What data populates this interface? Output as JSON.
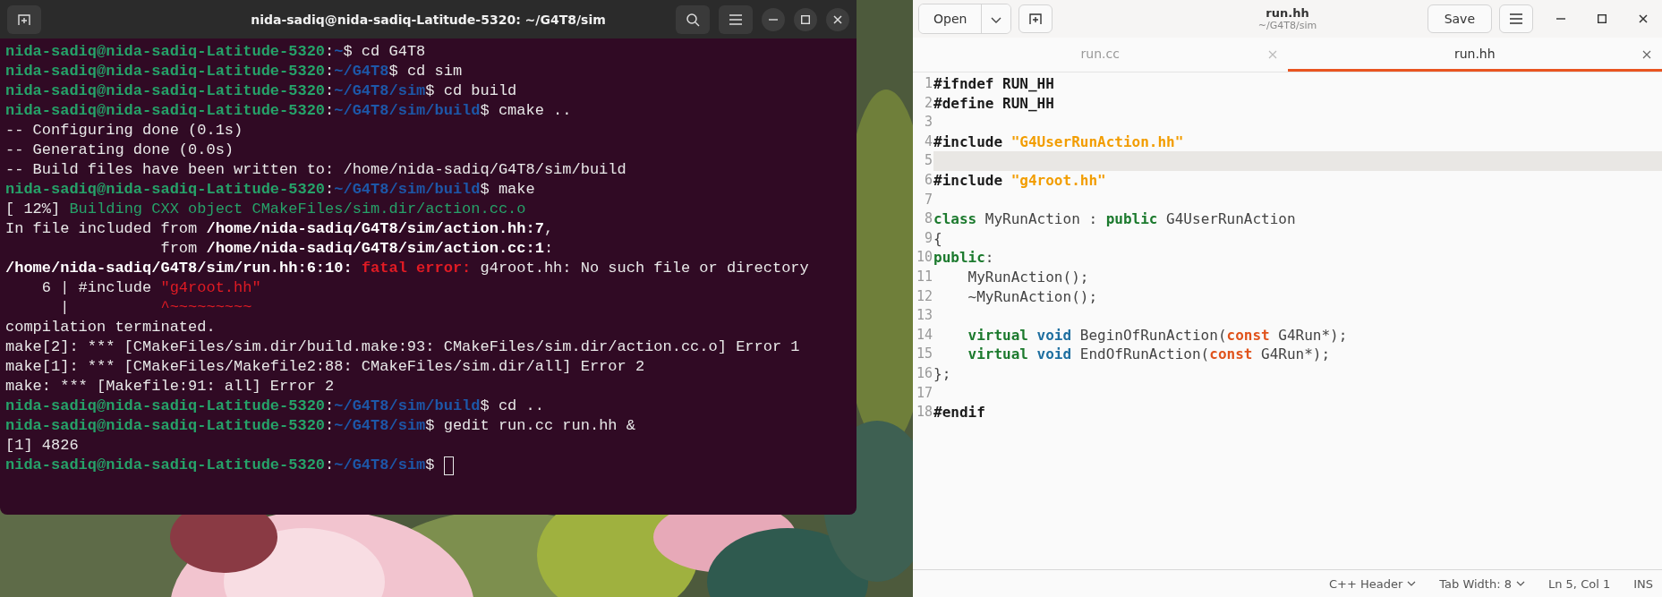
{
  "terminal": {
    "title": "nida-sadiq@nida-sadiq-Latitude-5320: ~/G4T8/sim",
    "cursor": true,
    "lines": [
      [
        {
          "kind": "user",
          "text": "nida-sadiq@nida-sadiq-Latitude-5320"
        },
        {
          "kind": "plain",
          "text": ":"
        },
        {
          "kind": "path",
          "text": "~"
        },
        {
          "kind": "plain",
          "text": "$ cd G4T8"
        }
      ],
      [
        {
          "kind": "user",
          "text": "nida-sadiq@nida-sadiq-Latitude-5320"
        },
        {
          "kind": "plain",
          "text": ":"
        },
        {
          "kind": "path",
          "text": "~/G4T8"
        },
        {
          "kind": "plain",
          "text": "$ cd sim"
        }
      ],
      [
        {
          "kind": "user",
          "text": "nida-sadiq@nida-sadiq-Latitude-5320"
        },
        {
          "kind": "plain",
          "text": ":"
        },
        {
          "kind": "path",
          "text": "~/G4T8/sim"
        },
        {
          "kind": "plain",
          "text": "$ cd build"
        }
      ],
      [
        {
          "kind": "user",
          "text": "nida-sadiq@nida-sadiq-Latitude-5320"
        },
        {
          "kind": "plain",
          "text": ":"
        },
        {
          "kind": "path",
          "text": "~/G4T8/sim/build"
        },
        {
          "kind": "plain",
          "text": "$ cmake .."
        }
      ],
      [
        {
          "kind": "plain",
          "text": "-- Configuring done (0.1s)"
        }
      ],
      [
        {
          "kind": "plain",
          "text": "-- Generating done (0.0s)"
        }
      ],
      [
        {
          "kind": "plain",
          "text": "-- Build files have been written to: /home/nida-sadiq/G4T8/sim/build"
        }
      ],
      [
        {
          "kind": "user",
          "text": "nida-sadiq@nida-sadiq-Latitude-5320"
        },
        {
          "kind": "plain",
          "text": ":"
        },
        {
          "kind": "path",
          "text": "~/G4T8/sim/build"
        },
        {
          "kind": "plain",
          "text": "$ make"
        }
      ],
      [
        {
          "kind": "plain",
          "text": "[ 12%] "
        },
        {
          "kind": "green",
          "text": "Building CXX object CMakeFiles/sim.dir/action.cc.o"
        }
      ],
      [
        {
          "kind": "plain",
          "text": "In file included from "
        },
        {
          "kind": "bold",
          "text": "/home/nida-sadiq/G4T8/sim/action.hh:7"
        },
        {
          "kind": "plain",
          "text": ","
        }
      ],
      [
        {
          "kind": "plain",
          "text": "                 from "
        },
        {
          "kind": "bold",
          "text": "/home/nida-sadiq/G4T8/sim/action.cc:1"
        },
        {
          "kind": "plain",
          "text": ":"
        }
      ],
      [
        {
          "kind": "bold",
          "text": "/home/nida-sadiq/G4T8/sim/run.hh:6:10: "
        },
        {
          "kind": "error",
          "text": "fatal error:"
        },
        {
          "kind": "plain",
          "text": " g4root.hh: No such file or directory"
        }
      ],
      [
        {
          "kind": "plain",
          "text": "    6 | #include "
        },
        {
          "kind": "red",
          "text": "\"g4root.hh\""
        }
      ],
      [
        {
          "kind": "plain",
          "text": "      |          "
        },
        {
          "kind": "red",
          "text": "^~~~~~~~~~"
        }
      ],
      [
        {
          "kind": "plain",
          "text": "compilation terminated."
        }
      ],
      [
        {
          "kind": "plain",
          "text": "make[2]: *** [CMakeFiles/sim.dir/build.make:93: CMakeFiles/sim.dir/action.cc.o] Error 1"
        }
      ],
      [
        {
          "kind": "plain",
          "text": "make[1]: *** [CMakeFiles/Makefile2:88: CMakeFiles/sim.dir/all] Error 2"
        }
      ],
      [
        {
          "kind": "plain",
          "text": "make: *** [Makefile:91: all] Error 2"
        }
      ],
      [
        {
          "kind": "user",
          "text": "nida-sadiq@nida-sadiq-Latitude-5320"
        },
        {
          "kind": "plain",
          "text": ":"
        },
        {
          "kind": "path",
          "text": "~/G4T8/sim/build"
        },
        {
          "kind": "plain",
          "text": "$ cd .."
        }
      ],
      [
        {
          "kind": "user",
          "text": "nida-sadiq@nida-sadiq-Latitude-5320"
        },
        {
          "kind": "plain",
          "text": ":"
        },
        {
          "kind": "path",
          "text": "~/G4T8/sim"
        },
        {
          "kind": "plain",
          "text": "$ gedit run.cc run.hh &"
        }
      ],
      [
        {
          "kind": "plain",
          "text": "[1] 4826"
        }
      ],
      [
        {
          "kind": "user",
          "text": "nida-sadiq@nida-sadiq-Latitude-5320"
        },
        {
          "kind": "plain",
          "text": ":"
        },
        {
          "kind": "path",
          "text": "~/G4T8/sim"
        },
        {
          "kind": "plain",
          "text": "$"
        }
      ]
    ]
  },
  "editor": {
    "open_button": "Open",
    "save_button": "Save",
    "title": "run.hh",
    "subtitle": "~/G4T8/sim",
    "tabs": [
      {
        "label": "run.cc",
        "selected": false
      },
      {
        "label": "run.hh",
        "selected": true
      }
    ],
    "lines": [
      {
        "number": "1",
        "current": false,
        "code": [
          {
            "kind": "pre",
            "text": "#ifndef RUN_HH"
          }
        ]
      },
      {
        "number": "2",
        "current": false,
        "code": [
          {
            "kind": "pre",
            "text": "#define RUN_HH"
          }
        ]
      },
      {
        "number": "3",
        "current": false
      },
      {
        "number": "4",
        "current": false,
        "code": [
          {
            "kind": "pre",
            "text": "#include "
          },
          {
            "kind": "str",
            "text": "\"G4UserRunAction.hh\""
          }
        ]
      },
      {
        "number": "5",
        "current": true
      },
      {
        "number": "6",
        "current": false,
        "code": [
          {
            "kind": "pre",
            "text": "#include "
          },
          {
            "kind": "str",
            "text": "\"g4root.hh\""
          }
        ]
      },
      {
        "number": "7",
        "current": false
      },
      {
        "number": "8",
        "current": false,
        "code": [
          {
            "kind": "kw",
            "text": "class"
          },
          {
            "kind": "plain",
            "text": " MyRunAction : "
          },
          {
            "kind": "kw",
            "text": "public"
          },
          {
            "kind": "plain",
            "text": " G4UserRunAction"
          }
        ]
      },
      {
        "number": "9",
        "current": false,
        "code": [
          {
            "kind": "plain",
            "text": "{"
          }
        ]
      },
      {
        "number": "10",
        "current": false,
        "code": [
          {
            "kind": "kw",
            "text": "public"
          },
          {
            "kind": "plain",
            "text": ":"
          }
        ]
      },
      {
        "number": "11",
        "current": false,
        "code": [
          {
            "kind": "plain",
            "text": "    MyRunAction();"
          }
        ]
      },
      {
        "number": "12",
        "current": false,
        "code": [
          {
            "kind": "plain",
            "text": "    ~MyRunAction();"
          }
        ]
      },
      {
        "number": "13",
        "current": false
      },
      {
        "number": "14",
        "current": false,
        "code": [
          {
            "kind": "kw",
            "text": "    virtual "
          },
          {
            "kind": "type",
            "text": "void"
          },
          {
            "kind": "plain",
            "text": " BeginOfRunAction("
          },
          {
            "kind": "const",
            "text": "const"
          },
          {
            "kind": "plain",
            "text": " G4Run*);"
          }
        ]
      },
      {
        "number": "15",
        "current": false,
        "code": [
          {
            "kind": "kw",
            "text": "    virtual "
          },
          {
            "kind": "type",
            "text": "void"
          },
          {
            "kind": "plain",
            "text": " EndOfRunAction("
          },
          {
            "kind": "const",
            "text": "const"
          },
          {
            "kind": "plain",
            "text": " G4Run*);"
          }
        ]
      },
      {
        "number": "16",
        "current": false,
        "code": [
          {
            "kind": "plain",
            "text": "};"
          }
        ]
      },
      {
        "number": "17",
        "current": false
      },
      {
        "number": "18",
        "current": false,
        "code": [
          {
            "kind": "pre",
            "text": "#endif"
          }
        ]
      }
    ],
    "status": {
      "language": "C++ Header",
      "tab_width": "Tab Width: 8",
      "position": "Ln 5, Col 1",
      "mode": "INS"
    }
  }
}
